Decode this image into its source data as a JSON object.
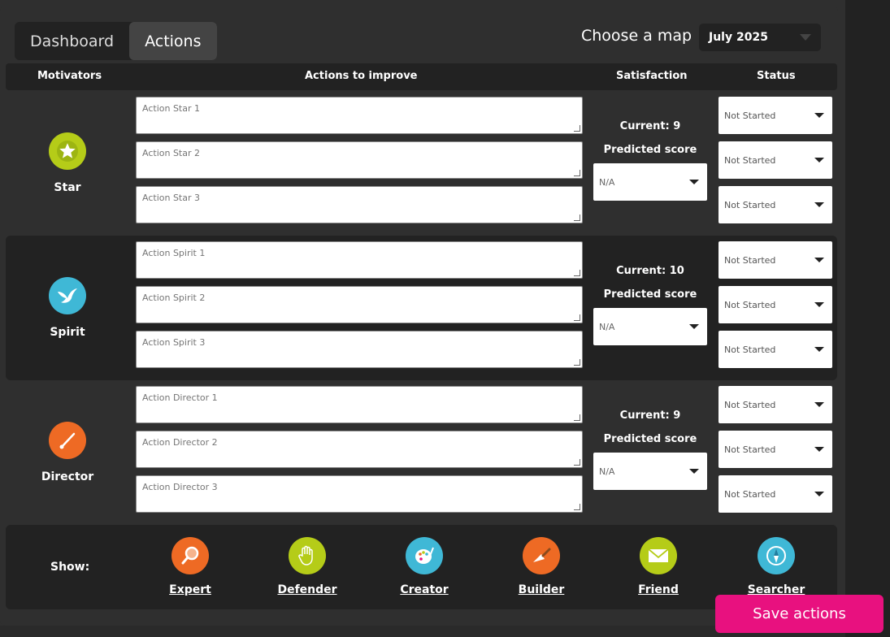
{
  "tabs": [
    {
      "label": "Dashboard"
    },
    {
      "label": "Actions"
    }
  ],
  "map": {
    "label": "Choose a map",
    "selected": "July 2025"
  },
  "headers": {
    "motivators": "Motivators",
    "actions": "Actions to improve",
    "satisfaction": "Satisfaction",
    "status": "Status"
  },
  "groups": [
    {
      "name": "Star",
      "icon": "star-icon",
      "color": "#b5cc18",
      "actions": [
        "Action Star 1",
        "Action Star 2",
        "Action Star 3"
      ],
      "current": "Current: 9",
      "predicted_label": "Predicted score",
      "predicted_value": "N/A",
      "statuses": [
        "Not Started",
        "Not Started",
        "Not Started"
      ]
    },
    {
      "name": "Spirit",
      "icon": "bird-icon",
      "color": "#3fb8d6",
      "actions": [
        "Action Spirit 1",
        "Action Spirit 2",
        "Action Spirit 3"
      ],
      "current": "Current: 10",
      "predicted_label": "Predicted score",
      "predicted_value": "N/A",
      "statuses": [
        "Not Started",
        "Not Started",
        "Not Started"
      ]
    },
    {
      "name": "Director",
      "icon": "baton-icon",
      "color": "#ee6a24",
      "actions": [
        "Action Director 1",
        "Action Director 2",
        "Action Director 3"
      ],
      "current": "Current: 9",
      "predicted_label": "Predicted score",
      "predicted_value": "N/A",
      "statuses": [
        "Not Started",
        "Not Started",
        "Not Started"
      ]
    }
  ],
  "show": {
    "label": "Show:",
    "items": [
      {
        "label": "Expert",
        "icon": "magnifier-icon",
        "color": "#ee6a24"
      },
      {
        "label": "Defender",
        "icon": "hand-icon",
        "color": "#b5cc18"
      },
      {
        "label": "Creator",
        "icon": "palette-icon",
        "color": "#3fb8d6"
      },
      {
        "label": "Builder",
        "icon": "trowel-icon",
        "color": "#ee6a24"
      },
      {
        "label": "Friend",
        "icon": "envelope-icon",
        "color": "#b5cc18"
      },
      {
        "label": "Searcher",
        "icon": "compass-icon",
        "color": "#3fb8d6"
      }
    ]
  },
  "save_label": "Save actions"
}
